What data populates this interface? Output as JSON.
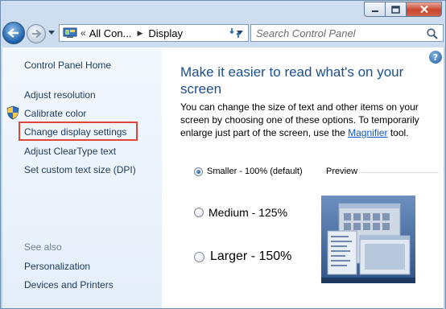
{
  "window": {
    "minimize_icon": "minimize-icon",
    "maximize_icon": "maximize-icon",
    "close_icon": "close-icon"
  },
  "navbar": {
    "back_icon": "back-arrow-icon",
    "forward_icon": "forward-arrow-icon",
    "address": {
      "icon": "control-panel-icon",
      "overflow": "«",
      "crumbs": [
        "All Con...",
        "Display"
      ]
    },
    "refresh_icon": "refresh-icon",
    "search": {
      "placeholder": "Search Control Panel",
      "value": ""
    }
  },
  "left_pane": {
    "home": "Control Panel Home",
    "links": [
      "Adjust resolution",
      "Calibrate color",
      "Change display settings",
      "Adjust ClearType text",
      "Set custom text size (DPI)"
    ],
    "highlighted_link_index": 2,
    "see_also_heading": "See also",
    "see_also": [
      "Personalization",
      "Devices and Printers"
    ]
  },
  "main_pane": {
    "help_icon": "help-icon",
    "help_glyph": "?",
    "title": "Make it easier to read what's on your screen",
    "description_before_link": "You can change the size of text and other items on your screen by choosing one of these options. To temporarily enlarge just part of the screen, use the ",
    "link_text": "Magnifier",
    "description_after_link": " tool.",
    "options": [
      {
        "label": "Smaller - 100% (default)",
        "selected": true
      },
      {
        "label": "Medium - 125%",
        "selected": false
      },
      {
        "label": "Larger - 150%",
        "selected": false
      }
    ],
    "preview_label": "Preview"
  },
  "colors": {
    "title_blue": "#1e4f8c",
    "link_blue": "#0b54c4",
    "highlight_red": "#e2453b",
    "left_pane_bg": "#eaf2fb"
  }
}
